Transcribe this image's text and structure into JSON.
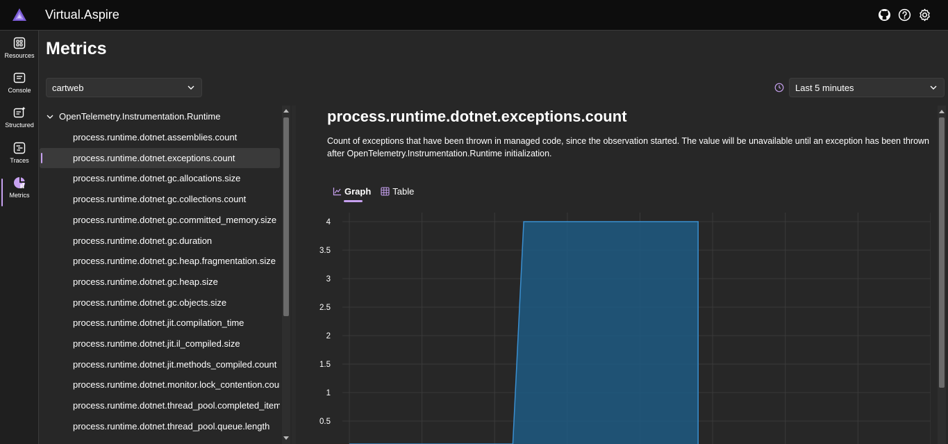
{
  "header": {
    "app_title": "Virtual.Aspire"
  },
  "nav": [
    {
      "label": "Resources",
      "icon": "resources-icon"
    },
    {
      "label": "Console",
      "icon": "console-icon"
    },
    {
      "label": "Structured",
      "icon": "structured-logs-icon"
    },
    {
      "label": "Traces",
      "icon": "traces-icon"
    },
    {
      "label": "Metrics",
      "icon": "metrics-icon",
      "active": true
    }
  ],
  "page": {
    "title": "Metrics"
  },
  "resource_select": {
    "value": "cartweb"
  },
  "time_select": {
    "value": "Last 5 minutes"
  },
  "tree": {
    "root": "OpenTelemetry.Instrumentation.Runtime",
    "items": [
      "process.runtime.dotnet.assemblies.count",
      "process.runtime.dotnet.exceptions.count",
      "process.runtime.dotnet.gc.allocations.size",
      "process.runtime.dotnet.gc.collections.count",
      "process.runtime.dotnet.gc.committed_memory.size",
      "process.runtime.dotnet.gc.duration",
      "process.runtime.dotnet.gc.heap.fragmentation.size",
      "process.runtime.dotnet.gc.heap.size",
      "process.runtime.dotnet.gc.objects.size",
      "process.runtime.dotnet.jit.compilation_time",
      "process.runtime.dotnet.jit.il_compiled.size",
      "process.runtime.dotnet.jit.methods_compiled.count",
      "process.runtime.dotnet.monitor.lock_contention.count",
      "process.runtime.dotnet.thread_pool.completed_items.count",
      "process.runtime.dotnet.thread_pool.queue.length"
    ],
    "selected_index": 1
  },
  "metric": {
    "title": "process.runtime.dotnet.exceptions.count",
    "description": "Count of exceptions that have been thrown in managed code, since the observation started. The value will be unavailable until an exception has been thrown after OpenTelemetry.Instrumentation.Runtime initialization."
  },
  "tabs": [
    {
      "label": "Graph",
      "active": true
    },
    {
      "label": "Table",
      "active": false
    }
  ],
  "colors": {
    "accent": "#c7a1f0",
    "series_fill": "#1f5a82",
    "series_line": "#3a8fd0"
  },
  "chart_data": {
    "type": "area",
    "y_ticks": [
      "4",
      "3.5",
      "3",
      "2.5",
      "2",
      "1.5",
      "1",
      "0.5"
    ],
    "ylim": [
      0,
      4
    ],
    "x": [
      0,
      2.25,
      2.4,
      4.8
    ],
    "y": [
      0,
      0,
      4,
      4
    ],
    "xlim": [
      0,
      8
    ],
    "grid": true
  }
}
